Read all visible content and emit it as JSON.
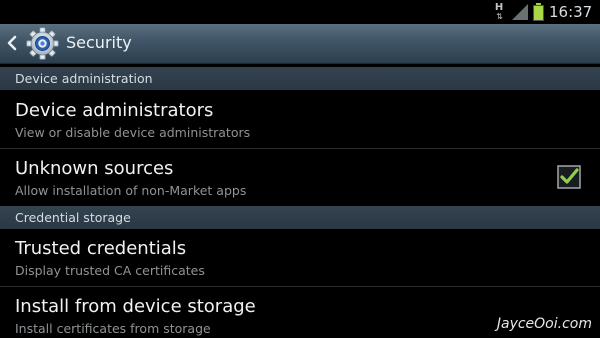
{
  "status_bar": {
    "network_type": "H",
    "time": "16:37"
  },
  "action_bar": {
    "title": "Security",
    "back_icon": "chevron-left-icon",
    "app_icon": "gear-icon"
  },
  "sections": [
    {
      "header": "Device administration",
      "items": [
        {
          "title": "Device administrators",
          "summary": "View or disable device administrators"
        },
        {
          "title": "Unknown sources",
          "summary": "Allow installation of non-Market apps",
          "checked": true
        }
      ]
    },
    {
      "header": "Credential storage",
      "items": [
        {
          "title": "Trusted credentials",
          "summary": "Display trusted CA certificates"
        },
        {
          "title": "Install from device storage",
          "summary": "Install certificates from storage"
        }
      ]
    }
  ],
  "watermark": "JayceOoi.com",
  "colors": {
    "accent_check": "#8fd14f",
    "action_bar": "#3f5566",
    "section_header": "#2e3d49"
  }
}
